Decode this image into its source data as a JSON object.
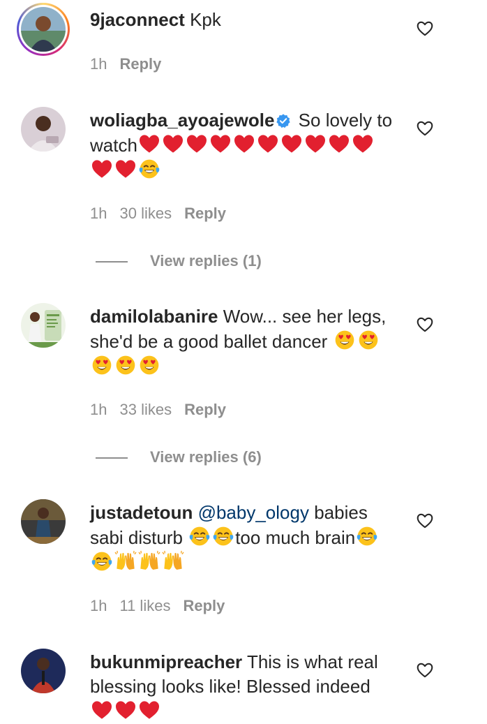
{
  "comments": [
    {
      "username": "9jaconnect",
      "text": "Kpk",
      "time": "1h",
      "likes": "",
      "reply_label": "Reply",
      "story_ring": true
    },
    {
      "username": "woliagba_ayoajewole",
      "verified": true,
      "text": "So lovely to watch",
      "time": "1h",
      "likes": "30 likes",
      "reply_label": "Reply",
      "view_replies": "View replies (1)"
    },
    {
      "username": "damilolabanire",
      "text": "Wow... see her legs, she'd be a good ballet dancer",
      "time": "1h",
      "likes": "33 likes",
      "reply_label": "Reply",
      "view_replies": "View replies (6)"
    },
    {
      "username": "justadetoun",
      "mention": "@baby_ology",
      "text_a": "babies sabi disturb",
      "text_b": "too much brain",
      "time": "1h",
      "likes": "11 likes",
      "reply_label": "Reply"
    },
    {
      "username": "bukunmipreacher",
      "text": "This is what real blessing looks like! Blessed indeed"
    }
  ],
  "icons": {
    "heart": "heart-outline-icon",
    "verified": "verified-badge-icon",
    "emoji_red_heart": "red-heart-emoji",
    "emoji_tears_of_joy": "face-with-tears-of-joy-emoji",
    "emoji_heart_eyes": "smiling-face-with-heart-eyes-emoji",
    "emoji_raising_hands": "raising-hands-emoji"
  },
  "colors": {
    "verified_blue": "#3897f0",
    "mention_blue": "#00376b",
    "meta_gray": "#8e8e8e"
  }
}
